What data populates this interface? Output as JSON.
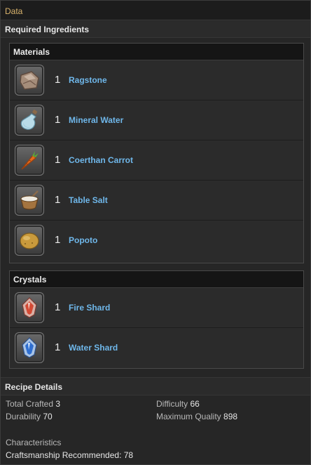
{
  "header": {
    "title": "Data"
  },
  "required": {
    "title": "Required Ingredients",
    "materials": {
      "title": "Materials",
      "items": [
        {
          "qty": "1",
          "name": "Ragstone",
          "icon": "ragstone-icon"
        },
        {
          "qty": "1",
          "name": "Mineral Water",
          "icon": "mineral-water-icon"
        },
        {
          "qty": "1",
          "name": "Coerthan Carrot",
          "icon": "coerthan-carrot-icon"
        },
        {
          "qty": "1",
          "name": "Table Salt",
          "icon": "table-salt-icon"
        },
        {
          "qty": "1",
          "name": "Popoto",
          "icon": "popoto-icon"
        }
      ]
    },
    "crystals": {
      "title": "Crystals",
      "items": [
        {
          "qty": "1",
          "name": "Fire Shard",
          "icon": "fire-shard-icon"
        },
        {
          "qty": "1",
          "name": "Water Shard",
          "icon": "water-shard-icon"
        }
      ]
    }
  },
  "recipe": {
    "title": "Recipe Details",
    "total_crafted_label": "Total Crafted",
    "total_crafted": "3",
    "difficulty_label": "Difficulty",
    "difficulty": "66",
    "durability_label": "Durability",
    "durability": "70",
    "max_quality_label": "Maximum Quality",
    "max_quality": "898",
    "characteristics_label": "Characteristics",
    "characteristics_value": "Craftsmanship Recommended: 78"
  },
  "colors": {
    "header_text": "#d9b36c",
    "item_link": "#6fb7ea",
    "panel_bg": "#262626"
  }
}
